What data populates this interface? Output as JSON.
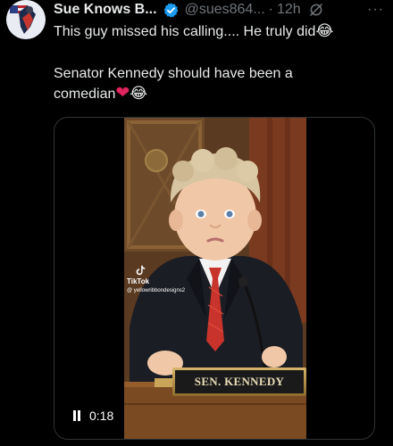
{
  "post": {
    "author_name": "Sue Knows B...",
    "handle": "@sues864...",
    "separator": "·",
    "time": "12h",
    "more": "···",
    "text_line1": "This guy missed his calling.... He truly did",
    "text_line2": "Senator Kennedy should have been a",
    "text_line3": "comedian",
    "emoji_laugh": "😂",
    "emoji_heart": "❤"
  },
  "video": {
    "watermark_brand": "TikTok",
    "watermark_user": "@ yellowribbondesigns2",
    "nameplate_text": "SEN. KENNEDY",
    "elapsed": "0:18"
  },
  "colors": {
    "background": "#000000",
    "text": "#e7e9ea",
    "muted": "#71767b",
    "verified": "#1d9bf0",
    "heart": "#e0245e"
  },
  "icons": [
    "verified-badge-icon",
    "grok-icon",
    "more-icon",
    "tiktok-logo-icon",
    "pause-icon"
  ]
}
